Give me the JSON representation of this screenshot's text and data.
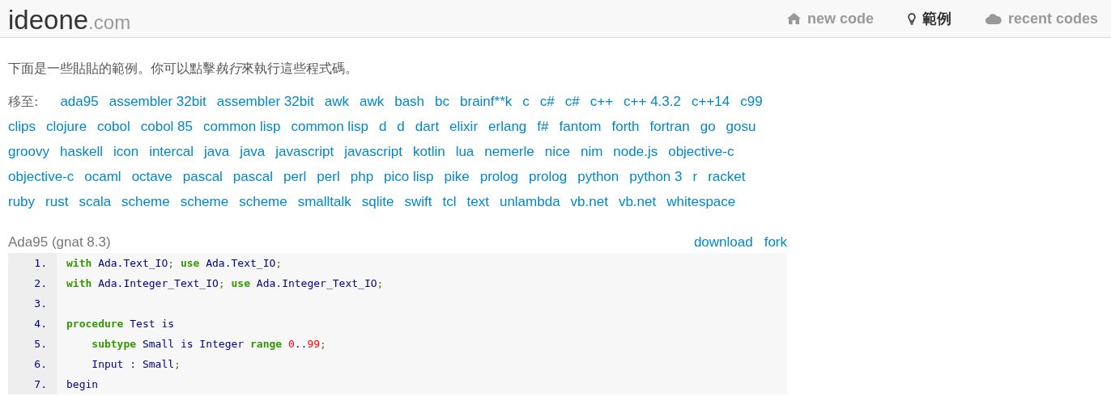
{
  "header": {
    "logo": {
      "name": "ideone",
      "suffix": ".com"
    },
    "nav": [
      {
        "label": "new code",
        "selected": false
      },
      {
        "label": "範例",
        "selected": true
      },
      {
        "label": "recent codes",
        "selected": false
      }
    ]
  },
  "intro": [
    {
      "text": "下面是一些貼貼的範例。你可以點擊",
      "italic": false
    },
    {
      "text": "執行",
      "italic": true
    },
    {
      "text": "來執行這些程式碼。",
      "italic": false
    }
  ],
  "goto": {
    "label": "移至:",
    "languages": [
      "ada95",
      "assembler 32bit",
      "assembler 32bit",
      "awk",
      "awk",
      "bash",
      "bc",
      "brainf**k",
      "c",
      "c#",
      "c#",
      "c++",
      "c++ 4.3.2",
      "c++14",
      "c99",
      "clips",
      "clojure",
      "cobol",
      "cobol 85",
      "common lisp",
      "common lisp",
      "d",
      "d",
      "dart",
      "elixir",
      "erlang",
      "f#",
      "fantom",
      "forth",
      "fortran",
      "go",
      "gosu",
      "groovy",
      "haskell",
      "icon",
      "intercal",
      "java",
      "java",
      "javascript",
      "javascript",
      "kotlin",
      "lua",
      "nemerle",
      "nice",
      "nim",
      "node.js",
      "objective-c",
      "objective-c",
      "ocaml",
      "octave",
      "pascal",
      "pascal",
      "perl",
      "perl",
      "php",
      "pico lisp",
      "pike",
      "prolog",
      "prolog",
      "python",
      "python 3",
      "r",
      "racket",
      "ruby",
      "rust",
      "scala",
      "scheme",
      "scheme",
      "scheme",
      "smalltalk",
      "sqlite",
      "swift",
      "tcl",
      "text",
      "unlambda",
      "vb.net",
      "vb.net",
      "whitespace"
    ]
  },
  "example": {
    "title": "Ada95 (gnat 8.3)",
    "actions": [
      "download",
      "fork"
    ],
    "lines": [
      {
        "number": "1.",
        "tokens": [
          {
            "kind": "keyword",
            "text": "with"
          },
          {
            "kind": "plain",
            "text": " Ada.Text_IO"
          },
          {
            "kind": "punct",
            "text": "; "
          },
          {
            "kind": "keyword",
            "text": "use"
          },
          {
            "kind": "plain",
            "text": " Ada.Text_IO"
          },
          {
            "kind": "punct",
            "text": ";"
          }
        ]
      },
      {
        "number": "2.",
        "tokens": [
          {
            "kind": "keyword",
            "text": "with"
          },
          {
            "kind": "plain",
            "text": " Ada.Integer_Text_IO"
          },
          {
            "kind": "punct",
            "text": "; "
          },
          {
            "kind": "keyword",
            "text": "use"
          },
          {
            "kind": "plain",
            "text": " Ada.Integer_Text_IO"
          },
          {
            "kind": "punct",
            "text": ";"
          }
        ]
      },
      {
        "number": "3."
      },
      {
        "number": "4.",
        "tokens": [
          {
            "kind": "keyword",
            "text": "procedure"
          },
          {
            "kind": "plain",
            "text": " Test is"
          }
        ]
      },
      {
        "number": "5.",
        "tokens": [
          {
            "kind": "keyword",
            "text": "    subtype"
          },
          {
            "kind": "plain",
            "text": " Small is Integer "
          },
          {
            "kind": "keyword",
            "text": "range "
          },
          {
            "kind": "number",
            "text": "0"
          },
          {
            "kind": "plain",
            "text": ".."
          },
          {
            "kind": "number",
            "text": "99"
          },
          {
            "kind": "punct",
            "text": ";"
          }
        ]
      },
      {
        "number": "6.",
        "tokens": [
          {
            "kind": "plain",
            "text": "    Input : Small"
          },
          {
            "kind": "punct",
            "text": ";"
          }
        ]
      },
      {
        "number": "7.",
        "tokens": [
          {
            "kind": "plain",
            "text": "begin"
          }
        ]
      }
    ]
  }
}
